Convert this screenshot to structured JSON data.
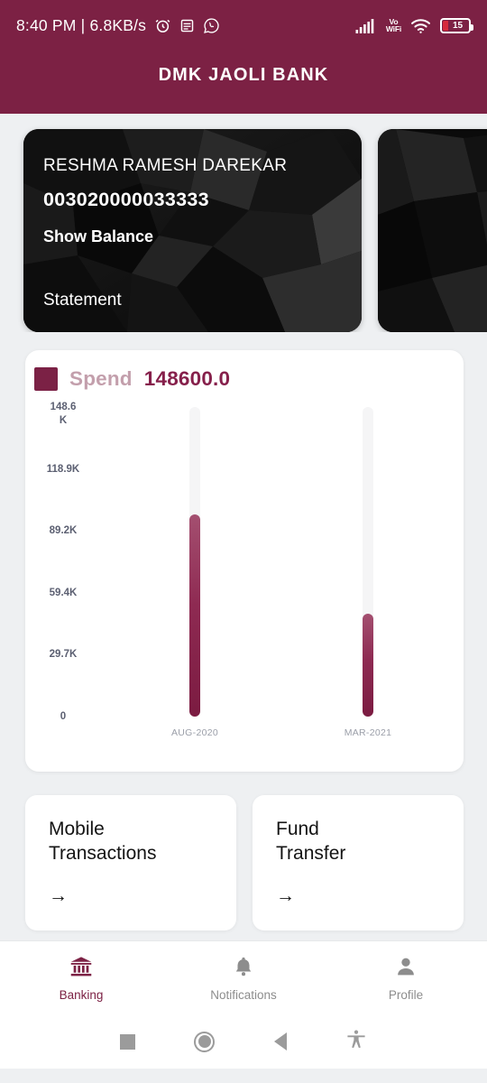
{
  "status_bar": {
    "time": "8:40 PM",
    "separator": "|",
    "network_speed": "6.8KB/s",
    "icons": [
      "alarm-icon",
      "message-icon",
      "whatsapp-icon"
    ],
    "signal": "signal-bars-icon",
    "vo_line1": "Vo",
    "vo_line2": "WiFi",
    "wifi": "wifi-icon",
    "battery_percent": "15"
  },
  "app_bar": {
    "title": "DMK JAOLI BANK"
  },
  "accounts": [
    {
      "name": "RESHMA RAMESH DAREKAR",
      "number": "003020000033333",
      "balance_label": "Show Balance",
      "statement_label": "Statement"
    },
    {
      "name": "",
      "number": "",
      "balance_label": "",
      "statement_label": ""
    }
  ],
  "chart_data": {
    "type": "bar",
    "title": "Spend",
    "total_label": "148600.0",
    "categories": [
      "AUG-2020",
      "MAR-2021"
    ],
    "values": [
      97000,
      49400
    ],
    "series": [
      {
        "name": "Spend",
        "values": [
          97000,
          49400
        ]
      }
    ],
    "ytick_labels": [
      "148.6\nK",
      "118.9K",
      "89.2K",
      "59.4K",
      "29.7K",
      "0"
    ],
    "ytick_values": [
      148600,
      118900,
      89200,
      59400,
      29700,
      0
    ],
    "ylim": [
      0,
      148600
    ],
    "xlabel": "",
    "ylabel": "",
    "grid": false,
    "legend_position": "top-left",
    "bar_color": "#7b2145",
    "track_color": "#f5f5f6"
  },
  "action_cards": [
    {
      "title": "Mobile\nTransactions",
      "arrow": "→"
    },
    {
      "title": "Fund\nTransfer",
      "arrow": "→"
    }
  ],
  "bottom_nav": {
    "items": [
      {
        "label": "Banking",
        "icon": "bank-icon",
        "active": true
      },
      {
        "label": "Notifications",
        "icon": "bell-icon",
        "active": false
      },
      {
        "label": "Profile",
        "icon": "person-icon",
        "active": false
      }
    ]
  },
  "android_nav": {
    "recent": "square-icon",
    "home": "circle-icon",
    "back": "triangle-back-icon",
    "accessibility": "accessibility-icon"
  },
  "colors": {
    "brand": "#7c2144",
    "chart_accent": "#7b2145",
    "legend_label": "#c39fac",
    "page_bg": "#eef0f2",
    "battery_level": "#d62b3c"
  }
}
